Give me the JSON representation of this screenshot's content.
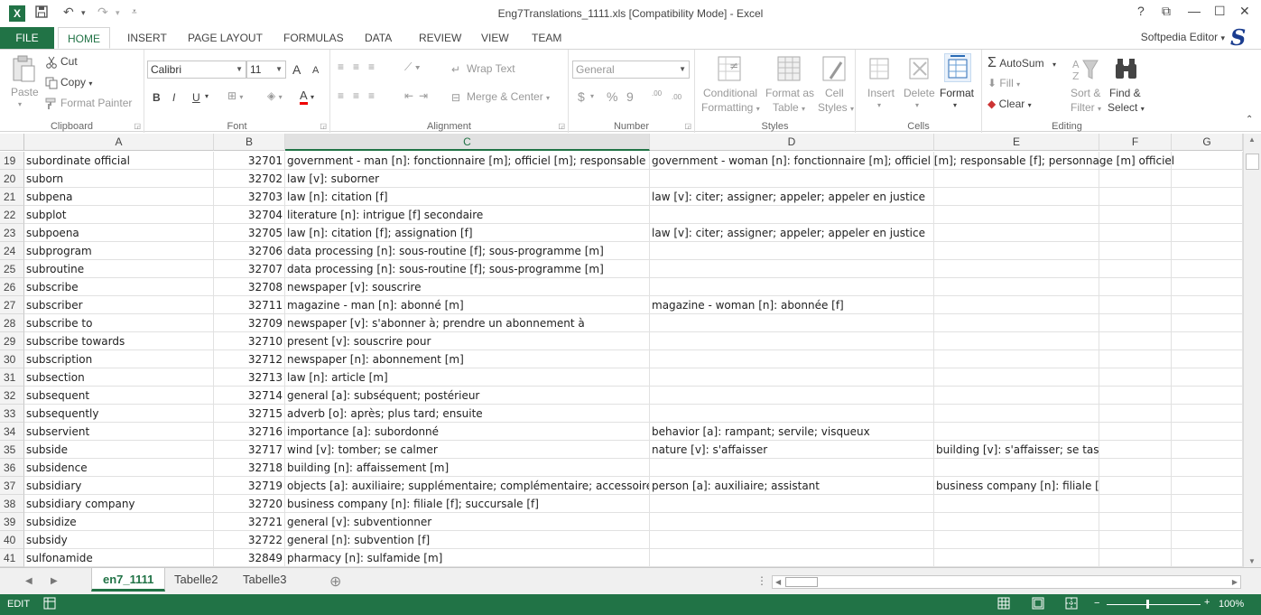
{
  "title_bar": {
    "title": "Eng7Translations_1111.xls  [Compatibility Mode] - Excel",
    "help": "?",
    "restore": "⧉",
    "minimize": "—",
    "maximize": "☐",
    "close": "✕"
  },
  "ribbon_tabs": {
    "file": "FILE",
    "tabs": [
      "HOME",
      "INSERT",
      "PAGE LAYOUT",
      "FORMULAS",
      "DATA",
      "REVIEW",
      "VIEW",
      "TEAM"
    ],
    "active": "HOME",
    "user": "Softpedia Editor"
  },
  "ribbon": {
    "clipboard": {
      "label": "Clipboard",
      "paste": "Paste",
      "cut": "Cut",
      "copy": "Copy",
      "format_painter": "Format Painter"
    },
    "font": {
      "label": "Font",
      "font_name": "Calibri",
      "font_size": "11",
      "bold": "B",
      "italic": "I",
      "underline": "U",
      "grow": "A",
      "shrink": "A",
      "font_color": "A"
    },
    "alignment": {
      "label": "Alignment",
      "wrap_text": "Wrap Text",
      "merge_center": "Merge & Center"
    },
    "number": {
      "label": "Number",
      "format": "General",
      "currency": "$",
      "percent": "%",
      "comma": "9",
      "inc_decimal": ".00",
      "dec_decimal": ".00"
    },
    "styles": {
      "label": "Styles",
      "conditional_formatting_1": "Conditional",
      "conditional_formatting_2": "Formatting",
      "format_as_table_1": "Format as",
      "format_as_table_2": "Table",
      "cell_styles_1": "Cell",
      "cell_styles_2": "Styles"
    },
    "cells": {
      "label": "Cells",
      "insert": "Insert",
      "delete": "Delete",
      "format": "Format"
    },
    "editing": {
      "label": "Editing",
      "autosum": "AutoSum",
      "fill": "Fill",
      "clear": "Clear",
      "sort_filter_1": "Sort &",
      "sort_filter_2": "Filter",
      "find_select_1": "Find &",
      "find_select_2": "Select"
    }
  },
  "grid": {
    "columns": [
      "A",
      "B",
      "C",
      "D",
      "E",
      "F",
      "G"
    ],
    "selected_column": "C",
    "rows": [
      {
        "n": "19",
        "a": "subordinate official",
        "b": "32701",
        "c": "government - man [n]: fonctionnaire [m]; officiel [m]; responsable [m]; personnage [m] officiel",
        "d": "government - woman [n]: fonctionnaire [m]; officiel [m]; responsable [f]; personnage [m] officiel",
        "e": ""
      },
      {
        "n": "20",
        "a": "suborn",
        "b": "32702",
        "c": "law [v]: suborner",
        "d": "",
        "e": ""
      },
      {
        "n": "21",
        "a": "subpena",
        "b": "32703",
        "c": "law [n]: citation [f]",
        "d": "law [v]: citer; assigner; appeler; appeler en justice",
        "e": ""
      },
      {
        "n": "22",
        "a": "subplot",
        "b": "32704",
        "c": "literature [n]: intrigue [f] secondaire",
        "d": "",
        "e": ""
      },
      {
        "n": "23",
        "a": "subpoena",
        "b": "32705",
        "c": "law [n]: citation [f]; assignation [f]",
        "d": "law [v]: citer; assigner; appeler; appeler en justice",
        "e": ""
      },
      {
        "n": "24",
        "a": "subprogram",
        "b": "32706",
        "c": "data processing [n]: sous-routine [f]; sous-programme [m]",
        "d": "",
        "e": ""
      },
      {
        "n": "25",
        "a": "subroutine",
        "b": "32707",
        "c": "data processing [n]: sous-routine [f]; sous-programme [m]",
        "d": "",
        "e": ""
      },
      {
        "n": "26",
        "a": "subscribe",
        "b": "32708",
        "c": "newspaper [v]: souscrire",
        "d": "",
        "e": ""
      },
      {
        "n": "27",
        "a": "subscriber",
        "b": "32711",
        "c": "magazine - man [n]: abonné [m]",
        "d": "magazine - woman [n]: abonnée [f]",
        "e": ""
      },
      {
        "n": "28",
        "a": "subscribe to",
        "b": "32709",
        "c": "newspaper [v]: s'abonner à; prendre un abonnement à",
        "d": "",
        "e": ""
      },
      {
        "n": "29",
        "a": "subscribe towards",
        "b": "32710",
        "c": "present [v]: souscrire pour",
        "d": "",
        "e": ""
      },
      {
        "n": "30",
        "a": "subscription",
        "b": "32712",
        "c": "newspaper [n]: abonnement [m]",
        "d": "",
        "e": ""
      },
      {
        "n": "31",
        "a": "subsection",
        "b": "32713",
        "c": "law [n]: article [m]",
        "d": "",
        "e": ""
      },
      {
        "n": "32",
        "a": "subsequent",
        "b": "32714",
        "c": "general [a]: subséquent; postérieur",
        "d": "",
        "e": ""
      },
      {
        "n": "33",
        "a": "subsequently",
        "b": "32715",
        "c": "adverb [o]: après; plus tard; ensuite",
        "d": "",
        "e": ""
      },
      {
        "n": "34",
        "a": "subservient",
        "b": "32716",
        "c": "importance [a]: subordonné",
        "d": "behavior [a]: rampant; servile; visqueux",
        "e": ""
      },
      {
        "n": "35",
        "a": "subside",
        "b": "32717",
        "c": "wind [v]: tomber; se calmer",
        "d": "nature [v]: s'affaisser",
        "e": "building [v]: s'affaisser; se tasser; se déniveler"
      },
      {
        "n": "36",
        "a": "subsidence",
        "b": "32718",
        "c": "building [n]: affaissement [m]",
        "d": "",
        "e": ""
      },
      {
        "n": "37",
        "a": "subsidiary",
        "b": "32719",
        "c": "objects [a]: auxiliaire; supplémentaire; complémentaire; accessoire",
        "d": "person [a]: auxiliaire; assistant",
        "e": "business company [n]: filiale [f]; succursale [f]"
      },
      {
        "n": "38",
        "a": "subsidiary company",
        "b": "32720",
        "c": "business company [n]: filiale [f]; succursale [f]",
        "d": "",
        "e": ""
      },
      {
        "n": "39",
        "a": "subsidize",
        "b": "32721",
        "c": "general [v]: subventionner",
        "d": "",
        "e": ""
      },
      {
        "n": "40",
        "a": "subsidy",
        "b": "32722",
        "c": "general [n]: subvention [f]",
        "d": "",
        "e": ""
      },
      {
        "n": "41",
        "a": "sulfonamide",
        "b": "32849",
        "c": "pharmacy [n]: sulfamide [m]",
        "d": "",
        "e": ""
      }
    ]
  },
  "sheets": {
    "tabs": [
      "en7_1111",
      "Tabelle2",
      "Tabelle3"
    ],
    "active": "en7_1111"
  },
  "status_bar": {
    "mode": "EDIT",
    "zoom": "100%"
  },
  "colors": {
    "excel_green": "#217346",
    "header_gray": "#f3f3f3"
  }
}
